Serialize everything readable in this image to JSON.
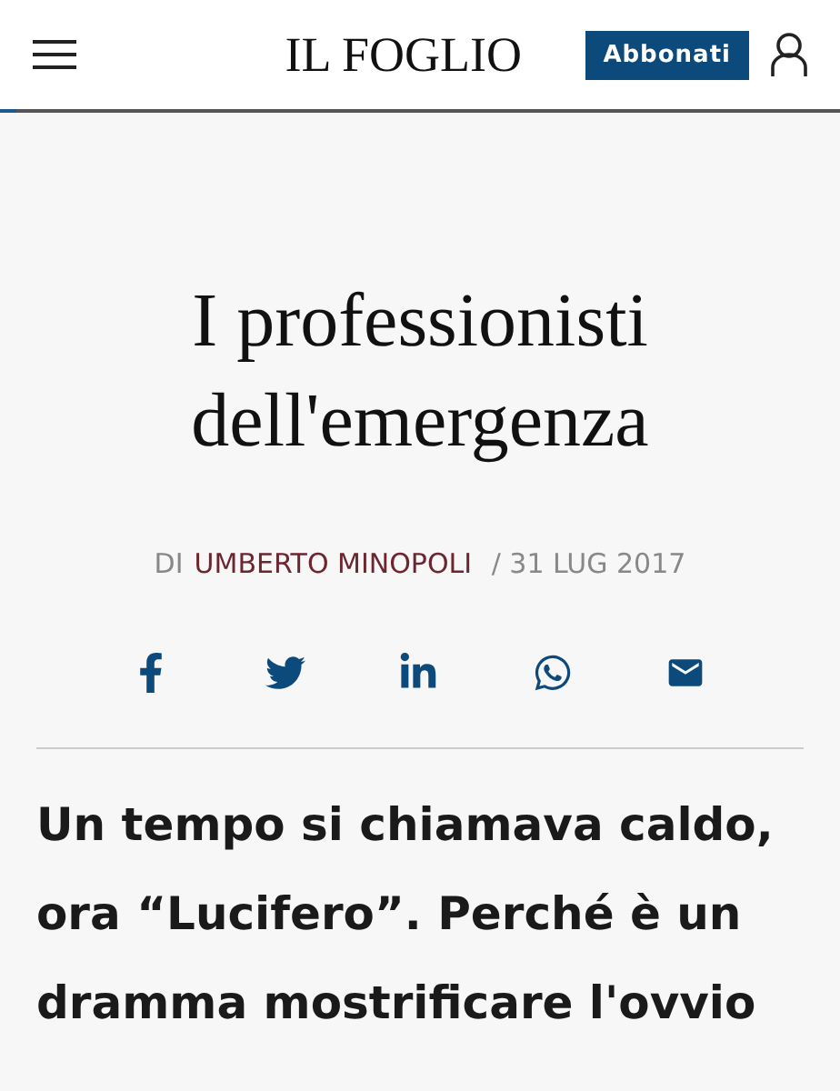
{
  "header": {
    "logo": "IL FOGLIO",
    "subscribe_button": "Abbonati",
    "reading_progress": {
      "level": 0.02
    }
  },
  "article": {
    "title": "I professionisti dell'emergenza",
    "byline": {
      "prefix": "DI",
      "author": "UMBERTO MINOPOLI",
      "date": "/ 31 LUG 2017"
    },
    "share": [
      {
        "kind": "facebook"
      },
      {
        "kind": "twitter"
      },
      {
        "kind": "linkedin"
      },
      {
        "kind": "whatsapp"
      },
      {
        "kind": "email"
      }
    ],
    "lead": "Un tempo si chiamava caldo, ora “Lucifero”. Perché è un dramma mostrificare l'ovvio"
  }
}
